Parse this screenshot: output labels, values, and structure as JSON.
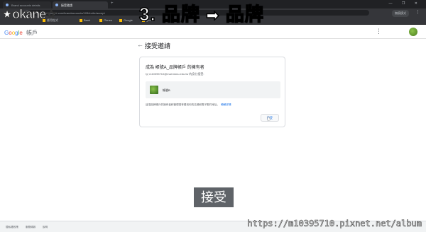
{
  "browser": {
    "tabs": [
      {
        "label": "Brand accounts details"
      },
      {
        "label": "接受邀請"
      }
    ],
    "new_tab": "+",
    "window_controls": "— ❐ ✕",
    "nav_buttons": "← → ⟳",
    "url": "myaccount.google.com/brandaccounts/103/invite/accept",
    "profile_chip": "無痕模式",
    "bookmarks": [
      "應用程式",
      "Bank",
      "iTunes",
      "Google",
      "gmail"
    ]
  },
  "overlay": {
    "step": "3. 品牌",
    "arrow": "➡",
    "target": "品牌",
    "watermark_logo": "★okane☆",
    "url_watermark": "https://m10395710.pixnet.net/album",
    "caption": "接受"
  },
  "google": {
    "logo": [
      "G",
      "o",
      "o",
      "g",
      "l",
      "e"
    ],
    "account_label": "帳戶"
  },
  "page": {
    "heading": "接受邀請",
    "card_title": "成為 帳號A_品牌帳戶 的擁有者",
    "card_email": "以 m10395710@mail.nknu.edu.tw 的身分接受:",
    "brand_name": "帳號B",
    "note": "這項品牌帳戶的擁有者和管理員會看到你的名稱和電子郵件地址。",
    "learn_more": "瞭解詳情",
    "accept_button": "接受"
  },
  "footer": {
    "links": [
      "隱私權政策",
      "服務條款",
      "說明"
    ]
  },
  "colors": {
    "accent": "#1a73e8",
    "chrome_dark": "#202124"
  }
}
